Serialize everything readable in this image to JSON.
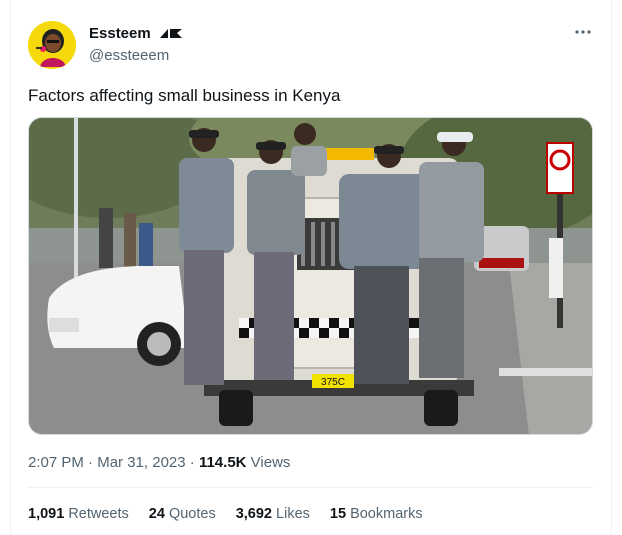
{
  "author": {
    "display_name": "Essteem",
    "handle": "@essteeem",
    "badge_icon": "verified-flag-icon",
    "avatar_icon": "avatar-cartoon-icon"
  },
  "tweet": {
    "text": "Factors affecting small business in Kenya",
    "more_icon": "more-options-icon",
    "photo_plate": "375C"
  },
  "meta": {
    "time": "2:07 PM",
    "separator": " · ",
    "date": "Mar 31, 2023",
    "views_count": "114.5K",
    "views_label": "Views"
  },
  "stats": {
    "retweets_count": "1,091",
    "retweets_label": "Retweets",
    "quotes_count": "24",
    "quotes_label": "Quotes",
    "likes_count": "3,692",
    "likes_label": "Likes",
    "bookmarks_count": "15",
    "bookmarks_label": "Bookmarks"
  },
  "colors": {
    "text_primary": "#0f1419",
    "text_secondary": "#536471",
    "avatar_bg": "#f5d90a",
    "border": "#eff3f4"
  }
}
